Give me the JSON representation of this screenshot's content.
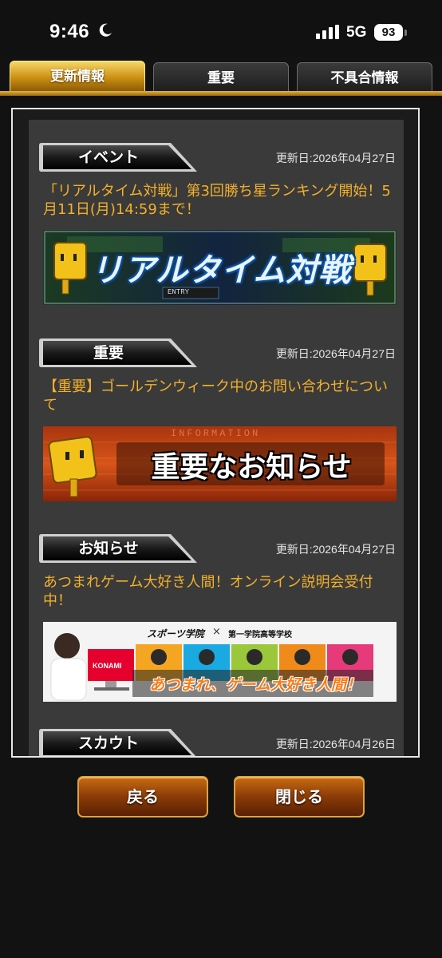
{
  "status_bar": {
    "time": "9:46",
    "network": "5G",
    "battery": "93"
  },
  "tabs": [
    {
      "label": "更新情報",
      "active": true
    },
    {
      "label": "重要",
      "active": false
    },
    {
      "label": "不具合情報",
      "active": false
    }
  ],
  "news": [
    {
      "category": "イベント",
      "date": "更新日:2026年04月27日",
      "title": "「リアルタイム対戦」第3回勝ち星ランキング開始！5月11日(月)14:59まで！",
      "banner_text": "リアルタイム対戦",
      "banner_small": "ENTRY"
    },
    {
      "category": "重要",
      "date": "更新日:2026年04月27日",
      "title": "【重要】ゴールデンウィーク中のお問い合わせについて",
      "banner_text": "重要なお知らせ",
      "banner_small": "INFORMATION"
    },
    {
      "category": "お知らせ",
      "date": "更新日:2026年04月27日",
      "title": "あつまれゲーム大好き人間！オンライン説明会受付中！",
      "banner_text": "あつまれ、ゲーム大好き人間！",
      "banner_brand1": "スポーツ学院",
      "banner_cross": "×",
      "banner_brand2": "第一学院高等学校",
      "banner_konami": "KONAMI"
    },
    {
      "category": "スカウト",
      "date": "更新日:2026年04月26日"
    }
  ],
  "buttons": {
    "back": "戻る",
    "close": "閉じる"
  },
  "colors": {
    "accent_gold": "#f3b12a",
    "panel": "#3a3a3a",
    "button_brown": "#8a3b07"
  }
}
